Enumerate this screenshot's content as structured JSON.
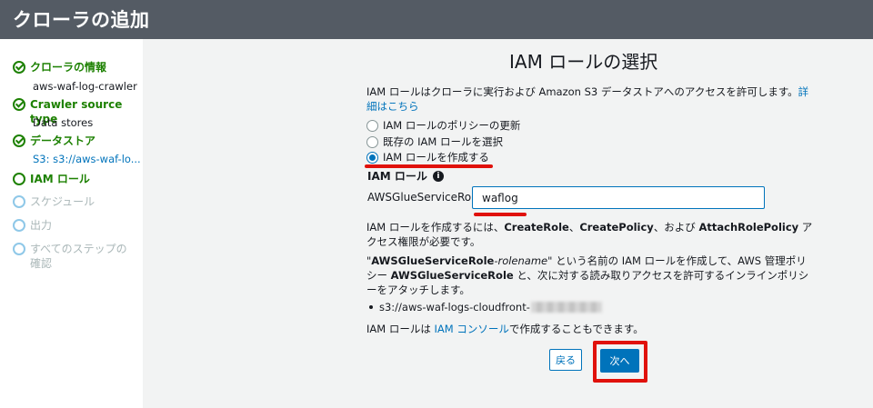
{
  "header": {
    "title": "クローラの追加"
  },
  "sidebar": {
    "steps": [
      {
        "label": "クローラの情報",
        "sub": "aws-waf-log-crawler",
        "status": "done"
      },
      {
        "label": "Crawler source type",
        "sub": "Data stores",
        "status": "done"
      },
      {
        "label": "データストア",
        "sub": "S3: s3://aws-waf-lo...",
        "status": "done"
      },
      {
        "label": "IAM ロール",
        "status": "current"
      },
      {
        "label": "スケジュール",
        "status": "pending"
      },
      {
        "label": "出力",
        "status": "pending"
      },
      {
        "label": "すべてのステップの確認",
        "status": "pending"
      }
    ]
  },
  "main": {
    "title": "IAM ロールの選択",
    "description": "IAM ロールはクローラに実行および Amazon S3 データストアへのアクセスを許可します。",
    "details_link": "詳細はこちら",
    "radio_options": [
      {
        "label": "IAM ロールのポリシーの更新",
        "checked": false
      },
      {
        "label": "既存の IAM ロールを選択",
        "checked": false
      },
      {
        "label": "IAM ロールを作成する",
        "checked": true
      }
    ],
    "iam_role_label": "IAM ロール",
    "info_icon": "i",
    "role_prefix": "AWSGlueServiceRole-",
    "role_input_value": "waflog",
    "permissions_note": {
      "pre": "IAM ロールを作成するには、",
      "p1": "CreateRole",
      "sep1": "、",
      "p2": "CreatePolicy",
      "sep2": "、および ",
      "p3": "AttachRolePolicy",
      "post": " アクセス権限が必要です。"
    },
    "create_note": {
      "q1": "\"",
      "bold1": "AWSGlueServiceRole",
      "italic1": "-rolename",
      "mid1": "\" という名前の IAM ロールを作成して、AWS 管理ポリシー ",
      "bold2": "AWSGlueServiceRole",
      "post": " と、次に対する読み取りアクセスを許可するインラインポリシーをアタッチします。"
    },
    "bullet_path": "s3://aws-waf-logs-cloudfront-",
    "console_note": {
      "pre": "IAM ロールは ",
      "link": "IAM コンソール",
      "post": "で作成することもできます。"
    },
    "back_button": "戻る",
    "next_button": "次へ"
  },
  "colors": {
    "accent": "#0073bb",
    "success": "#1d8102",
    "highlight": "#e0110b",
    "header_bg": "#545b64"
  }
}
